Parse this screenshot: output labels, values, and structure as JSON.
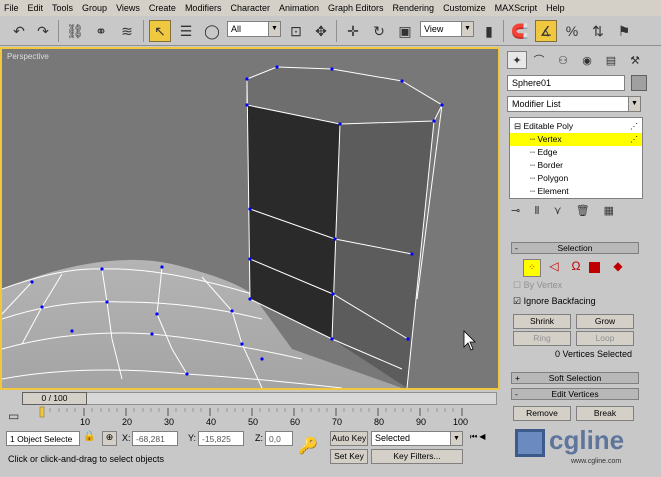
{
  "menu": [
    "File",
    "Edit",
    "Tools",
    "Group",
    "Views",
    "Create",
    "Modifiers",
    "Character",
    "Animation",
    "Graph Editors",
    "Rendering",
    "Customize",
    "MAXScript",
    "Help"
  ],
  "toolbar": {
    "selection_filter": "All",
    "coord_system": "View",
    "icons": [
      "undo-icon",
      "redo-icon",
      "select-and-link-icon",
      "unlink-icon",
      "bind-space-warp-icon",
      "select-object-icon",
      "select-by-name-icon",
      "selection-region-icon",
      "window-crossing-icon",
      "select-move-icon",
      "select-rotate-icon",
      "select-scale-icon",
      "pivot-icon",
      "snap-toggle-icon",
      "angle-snap-icon",
      "percent-snap-icon",
      "spinner-snap-icon"
    ]
  },
  "viewport": {
    "label": "Perspective",
    "colors": {
      "background": "#787878",
      "border": "#f0c840",
      "wire": "#ffffff",
      "vertex": "#0000ff"
    }
  },
  "command_panel": {
    "object_name": "Sphere01",
    "object_color": "#a0a0a0",
    "modifier_list": "Modifier List",
    "stack": [
      {
        "label": "Editable Poly",
        "selected": false
      },
      {
        "label": "Vertex",
        "selected": true
      },
      {
        "label": "Edge",
        "selected": false
      },
      {
        "label": "Border",
        "selected": false
      },
      {
        "label": "Polygon",
        "selected": false
      },
      {
        "label": "Element",
        "selected": false
      }
    ],
    "selection_rollout": {
      "title": "Selection",
      "by_vertex": "By Vertex",
      "ignore_backfacing": "Ignore Backfacing",
      "shrink": "Shrink",
      "grow": "Grow",
      "ring": "Ring",
      "loop": "Loop",
      "status": "0 Vertices Selected"
    },
    "soft_selection": "Soft Selection",
    "edit_vertices": "Edit Vertices",
    "remove": "Remove",
    "break": "Break"
  },
  "timeline": {
    "frame": "0 / 100",
    "ticks": [
      "10",
      "20",
      "30",
      "40",
      "50",
      "60",
      "70",
      "80",
      "90",
      "100"
    ]
  },
  "status": {
    "selected_count": "1 Object Selecte",
    "x_label": "X:",
    "x_value": "-68,281",
    "y_label": "Y:",
    "y_value": "-15,825",
    "z_label": "Z:",
    "z_value": "0,0",
    "auto_key": "Auto Key",
    "key_mode": "Selected",
    "set_key": "Set Key",
    "key_filters": "Key Filters...",
    "prompt": "Click or click-and-drag to select objects"
  },
  "watermark": {
    "logo": "cgline",
    "url": "www.cgline.com"
  }
}
